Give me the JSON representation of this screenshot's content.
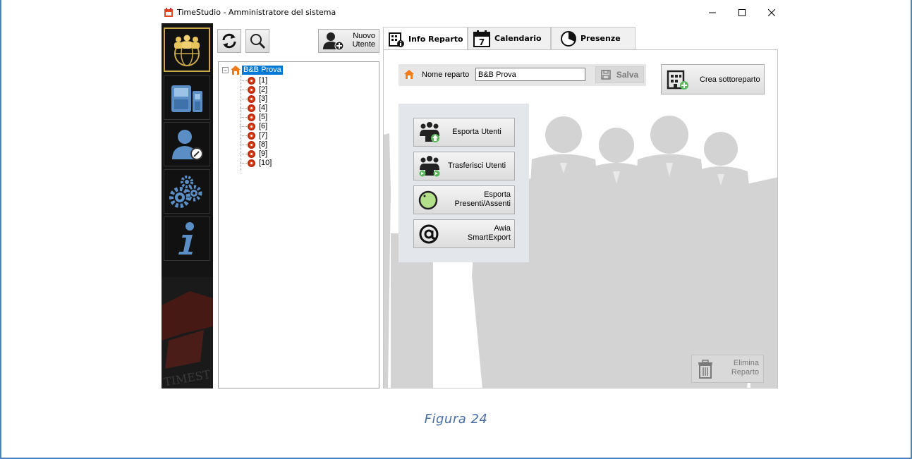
{
  "window": {
    "title": "TimeStudio - Amministratore del sistema",
    "controls": {
      "minimize": "minimize-icon",
      "maximize": "maximize-icon",
      "close": "close-icon"
    }
  },
  "nav": {
    "items": [
      {
        "name": "users-globe",
        "icon": "users-globe-icon",
        "active": true
      },
      {
        "name": "terminals",
        "icon": "terminal-devices-icon",
        "active": false
      },
      {
        "name": "user-key",
        "icon": "user-key-icon",
        "active": false
      },
      {
        "name": "settings",
        "icon": "gears-icon",
        "active": false
      },
      {
        "name": "info",
        "icon": "info-icon",
        "active": false
      }
    ],
    "brand_text": "TIMEST"
  },
  "toolbar": {
    "refresh_icon": "refresh-icon",
    "search_icon": "search-icon",
    "new_user_line1": "Nuovo",
    "new_user_line2": "Utente"
  },
  "tree": {
    "root_label": "B&B Prova",
    "nodes": [
      "[1]",
      "[2]",
      "[3]",
      "[4]",
      "[5]",
      "[6]",
      "[7]",
      "[8]",
      "[9]",
      "[10]"
    ]
  },
  "tabs": [
    {
      "label": "Info Reparto",
      "icon": "department-info-icon",
      "active": true
    },
    {
      "label": "Calendario",
      "icon": "calendar-icon",
      "active": false,
      "day": "7"
    },
    {
      "label": "Presenze",
      "icon": "clock-icon",
      "active": false
    }
  ],
  "department": {
    "name_label": "Nome reparto",
    "name_value": "B&B Prova",
    "save_label": "Salva",
    "create_sub_label": "Crea sottoreparto"
  },
  "actions": {
    "export_users": "Esporta Utenti",
    "transfer_users": "Trasferisci Utenti",
    "export_present_line1": "Esporta",
    "export_present_line2": "Presenti/Assenti",
    "awia_line1": "Awia",
    "awia_line2": "SmartExport"
  },
  "delete": {
    "line1": "Elimina",
    "line2": "Reparto"
  },
  "caption": "Figura 24",
  "colors": {
    "accent": "#0078d7",
    "gold": "#c8a94a",
    "node_red": "#e0401a",
    "caption": "#4a6fa5"
  }
}
